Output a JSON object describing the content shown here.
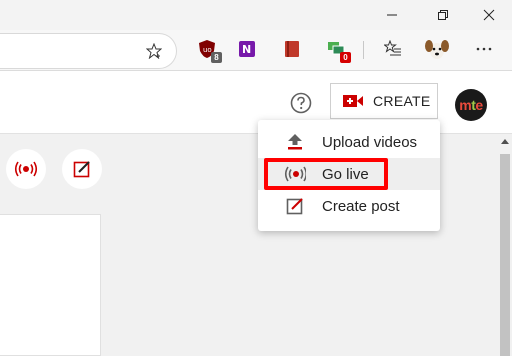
{
  "browser": {
    "window_controls": [
      "minimize-icon",
      "restore-icon",
      "close-icon"
    ],
    "star_icon": "add-favorite-icon",
    "extensions": [
      {
        "name": "ublock-origin",
        "badge": "8",
        "color": "#800000",
        "badge_color": "#606060"
      },
      {
        "name": "onenote",
        "color": "#7719aa"
      },
      {
        "name": "book-extension",
        "color": "#c0392b"
      },
      {
        "name": "screen-extension",
        "badge": "0",
        "color": "#2e8b57",
        "badge_color": "#d50000"
      },
      {
        "name": "favorites-list",
        "color": "#333333"
      },
      {
        "name": "profile-dog",
        "color": "#8b5a2b"
      },
      {
        "name": "more-menu",
        "color": "#333333"
      }
    ]
  },
  "header": {
    "help_icon": "help-icon",
    "create": {
      "label": "CREATE",
      "icon": "video-add-icon",
      "accent": "#cc0000"
    },
    "avatar": {
      "text_parts": [
        "m",
        "t",
        "e"
      ],
      "colors": [
        "#e94b3c",
        "#9ec94a",
        "#e94b3c"
      ]
    }
  },
  "quick_actions": [
    {
      "icon": "go-live-icon"
    },
    {
      "icon": "create-post-icon"
    }
  ],
  "create_menu": {
    "items": [
      {
        "label": "Upload videos",
        "icon": "upload-icon",
        "highlighted": false
      },
      {
        "label": "Go live",
        "icon": "go-live-icon",
        "highlighted": true
      },
      {
        "label": "Create post",
        "icon": "create-post-icon",
        "highlighted": false
      }
    ]
  },
  "colors": {
    "youtube_red": "#cc0000",
    "highlight_box": "#ff0000"
  }
}
